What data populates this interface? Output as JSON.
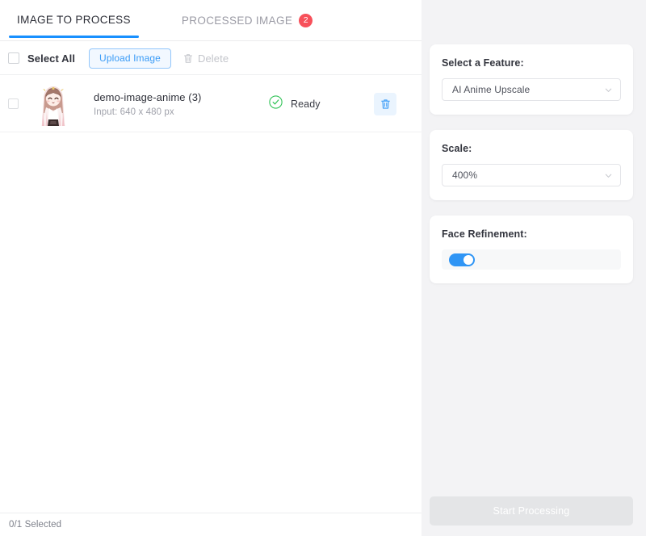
{
  "tabs": [
    {
      "label": "IMAGE TO PROCESS",
      "active": true,
      "badge": null
    },
    {
      "label": "PROCESSED IMAGE",
      "active": false,
      "badge": "2"
    }
  ],
  "toolbar": {
    "select_all_label": "Select All",
    "upload_label": "Upload Image",
    "delete_label": "Delete",
    "delete_icon": "trash-icon"
  },
  "list": {
    "rows": [
      {
        "name": "demo-image-anime (3)",
        "sub": "Input: 640 x 480 px",
        "status": "Ready",
        "status_icon": "check-circle-icon",
        "delete_icon": "trash-icon",
        "selected": false
      }
    ]
  },
  "footer": {
    "selection_text": "0/1 Selected"
  },
  "sidebar": {
    "feature": {
      "label": "Select a Feature:",
      "value": "AI Anime Upscale",
      "chevron_icon": "chevron-down-icon"
    },
    "scale": {
      "label": "Scale:",
      "value": "400%",
      "chevron_icon": "chevron-down-icon"
    },
    "face_refinement": {
      "label": "Face Refinement:",
      "enabled": true
    },
    "start_button": {
      "label": "Start Processing",
      "disabled": true
    }
  },
  "colors": {
    "accent": "#1890ff",
    "badge": "#f7505a",
    "success": "#2ec255",
    "toggle_on": "#2f95f5",
    "sidebar_bg": "#f3f3f5"
  }
}
